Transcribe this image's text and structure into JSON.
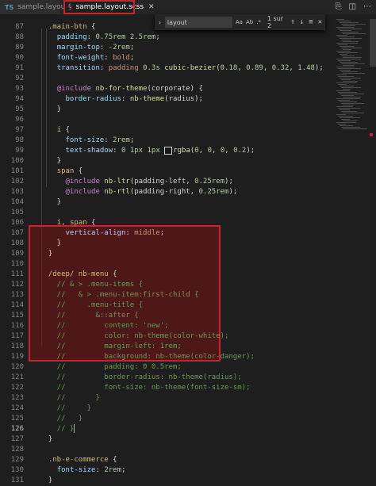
{
  "tabs": [
    {
      "icon": "TS",
      "label": "sample.layout.ts"
    },
    {
      "icon": "§",
      "label": "sample.layout.scss"
    }
  ],
  "find": {
    "query": "layout",
    "options": [
      "Aa",
      "Ab",
      ".*"
    ],
    "count": "1 sur 2"
  },
  "editor": {
    "lines": [
      {
        "n": "87",
        "text": "  .main-btn {"
      },
      {
        "n": "88",
        "text": "    padding: 0.75rem 2.5rem;"
      },
      {
        "n": "89",
        "text": "    margin-top: -2rem;"
      },
      {
        "n": "90",
        "text": "    font-weight: bold;"
      },
      {
        "n": "91",
        "text": "    transition: padding 0.3s cubic-bezier(0.18, 0.89, 0.32, 1.48);"
      },
      {
        "n": "92",
        "text": ""
      },
      {
        "n": "93",
        "text": "    @include nb-for-theme(corporate) {"
      },
      {
        "n": "94",
        "text": "      border-radius: nb-theme(radius);"
      },
      {
        "n": "95",
        "text": "    }"
      },
      {
        "n": "96",
        "text": ""
      },
      {
        "n": "97",
        "text": "    i {"
      },
      {
        "n": "98",
        "text": "      font-size: 2rem;"
      },
      {
        "n": "99",
        "text": "      text-shadow: 0 1px 1px rgba(0, 0, 0, 0.2);"
      },
      {
        "n": "100",
        "text": "    }"
      },
      {
        "n": "101",
        "text": "    span {"
      },
      {
        "n": "102",
        "text": "      @include nb-ltr(padding-left, 0.25rem);"
      },
      {
        "n": "103",
        "text": "      @include nb-rtl(padding-right, 0.25rem);"
      },
      {
        "n": "104",
        "text": "    }"
      },
      {
        "n": "105",
        "text": ""
      },
      {
        "n": "106",
        "text": "    i, span {"
      },
      {
        "n": "107",
        "text": "      vertical-align: middle;"
      },
      {
        "n": "108",
        "text": "    }"
      },
      {
        "n": "109",
        "text": "  }"
      },
      {
        "n": "110",
        "text": ""
      },
      {
        "n": "111",
        "text": "  /deep/ nb-menu {"
      },
      {
        "n": "112",
        "text": "    // & > .menu-items {"
      },
      {
        "n": "113",
        "text": "    //   & > .menu-item:first-child {"
      },
      {
        "n": "114",
        "text": "    //     .menu-title {"
      },
      {
        "n": "115",
        "text": "    //       &::after {"
      },
      {
        "n": "116",
        "text": "    //         content: 'new';"
      },
      {
        "n": "117",
        "text": "    //         color: nb-theme(color-white);"
      },
      {
        "n": "118",
        "text": "    //         margin-left: 1rem;"
      },
      {
        "n": "119",
        "text": "    //         background: nb-theme(color-danger);"
      },
      {
        "n": "120",
        "text": "    //         padding: 0 0.5rem;"
      },
      {
        "n": "121",
        "text": "    //         border-radius: nb-theme(radius);"
      },
      {
        "n": "122",
        "text": "    //         font-size: nb-theme(font-size-sm);"
      },
      {
        "n": "123",
        "text": "    //       }"
      },
      {
        "n": "124",
        "text": "    //     }"
      },
      {
        "n": "125",
        "text": "    //   }"
      },
      {
        "n": "126",
        "text": "    // }"
      },
      {
        "n": "127",
        "text": "  }"
      },
      {
        "n": "128",
        "text": ""
      },
      {
        "n": "129",
        "text": "  .nb-e-commerce {"
      },
      {
        "n": "130",
        "text": "    font-size: 2rem;"
      },
      {
        "n": "131",
        "text": "  }"
      }
    ]
  },
  "accent_color": "#c8242b"
}
